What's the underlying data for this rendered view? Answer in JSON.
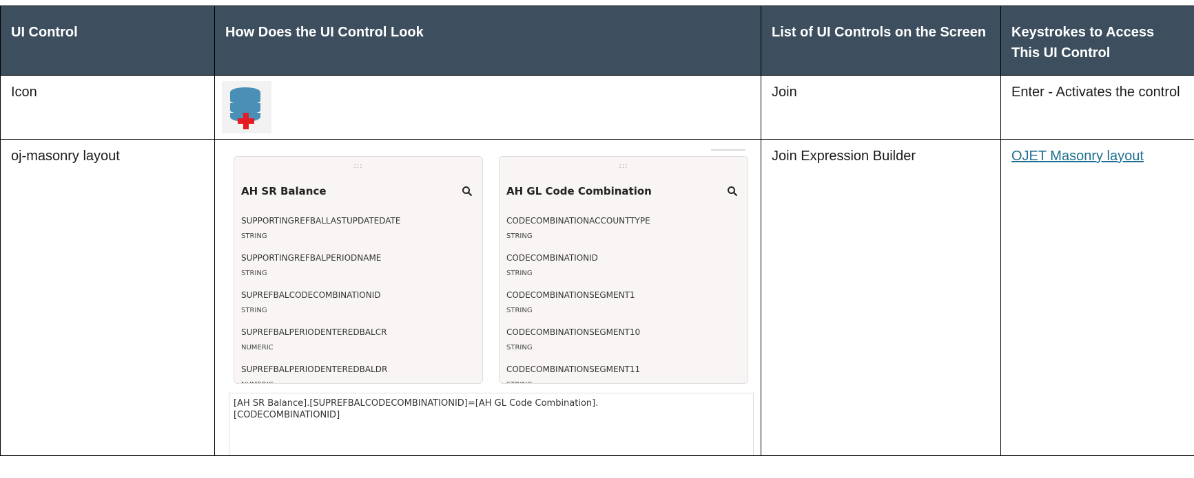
{
  "table": {
    "headers": [
      "UI Control",
      "How Does the UI Control Look",
      "List of UI Controls on the Screen",
      "Keystrokes to Access This UI Control"
    ],
    "rows": [
      {
        "control": "Icon",
        "screen_controls": "Join",
        "keystrokes": "Enter - Activates the control"
      },
      {
        "control": "oj-masonry layout",
        "screen_controls": "Join Expression Builder",
        "keystrokes": "OJET Masonry layout"
      }
    ]
  },
  "icon": {
    "name": "database-add-icon",
    "colors": {
      "cylinder": "#4a8fb5",
      "plus": "#e31b23"
    }
  },
  "screenshot": {
    "drag_handle": ":::",
    "cards": [
      {
        "title": "AH SR Balance",
        "fields": [
          {
            "name": "SUPPORTINGREFBALLASTUPDATEDATE",
            "type": "STRING"
          },
          {
            "name": "SUPPORTINGREFBALPERIODNAME",
            "type": "STRING"
          },
          {
            "name": "SUPREFBALCODECOMBINATIONID",
            "type": "STRING"
          },
          {
            "name": "SUPREFBALPERIODENTEREDBALCR",
            "type": "NUMERIC"
          },
          {
            "name": "SUPREFBALPERIODENTEREDBALDR",
            "type": "NUMERIC"
          }
        ]
      },
      {
        "title": "AH GL Code Combination",
        "fields": [
          {
            "name": "CODECOMBINATIONACCOUNTTYPE",
            "type": "STRING"
          },
          {
            "name": "CODECOMBINATIONID",
            "type": "STRING"
          },
          {
            "name": "CODECOMBINATIONSEGMENT1",
            "type": "STRING"
          },
          {
            "name": "CODECOMBINATIONSEGMENT10",
            "type": "STRING"
          },
          {
            "name": "CODECOMBINATIONSEGMENT11",
            "type": "STRING"
          }
        ]
      }
    ],
    "expression_line1": "[AH SR Balance].[SUPREFBALCODECOMBINATIONID]=[AH GL Code Combination].",
    "expression_line2": "[CODECOMBINATIONID]"
  }
}
